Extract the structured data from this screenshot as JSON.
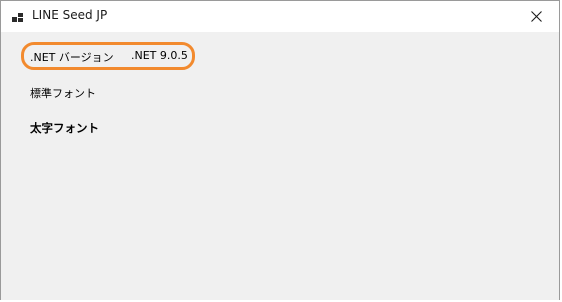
{
  "window": {
    "title": "LINE Seed JP",
    "icon": "app-window-icon",
    "close_icon": "close-icon"
  },
  "content": {
    "version_label": ".NET バージョン",
    "version_value": ".NET 9.0.5",
    "normal_font_label": "標準フォント",
    "bold_font_label": "太字フォント"
  },
  "colors": {
    "highlight": "#f28a2e",
    "client_bg": "#f0f0f0",
    "titlebar_bg": "#ffffff"
  }
}
